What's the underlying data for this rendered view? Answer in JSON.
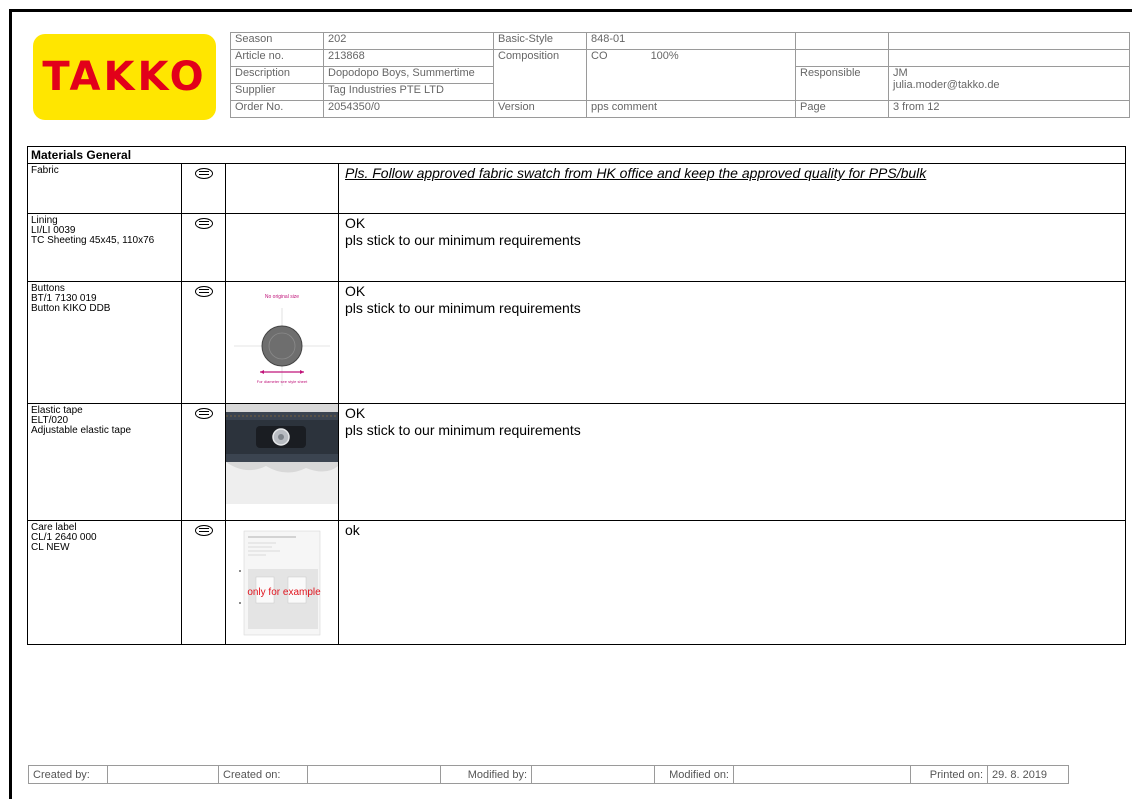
{
  "logo": {
    "text": "TAKKO",
    "colors": {
      "background": "#ffe600",
      "text": "#e2001a"
    }
  },
  "header": {
    "season_label": "Season",
    "season_value": "202",
    "basic_style_label": "Basic-Style",
    "basic_style_value": "848-01",
    "article_label": "Article no.",
    "article_value": "213868",
    "composition_label": "Composition",
    "composition_material": "CO",
    "composition_percent": "100%",
    "description_label": "Description",
    "description_value": "Dopodopo Boys, Summertime",
    "responsible_label": "Responsible",
    "responsible_initials": "JM",
    "responsible_email": "julia.moder@takko.de",
    "supplier_label": "Supplier",
    "supplier_value": "Tag Industries PTE LTD",
    "order_label": "Order No.",
    "order_value": "2054350/0",
    "version_label": "Version",
    "version_value": "pps comment",
    "page_label": "Page",
    "page_value": "3 from 12"
  },
  "materials": {
    "title": "Materials General",
    "rows": [
      {
        "label_lines": [
          "Fabric"
        ],
        "icon": "comment-icon",
        "comment_lines": [
          "Pls. Follow approved fabric swatch from HK office and keep the approved quality for PPS/bulk"
        ]
      },
      {
        "label_lines": [
          "Lining",
          "LI/LI 0039",
          "TC Sheeting 45x45, 110x76"
        ],
        "icon": "comment-icon",
        "comment_lines": [
          "OK",
          "pls stick to our minimum requirements"
        ]
      },
      {
        "label_lines": [
          "Buttons",
          "BT/1  7130 019",
          "Button KIKO DDB"
        ],
        "icon": "comment-icon",
        "image_text": {
          "top": "No original size",
          "bottom": "For diameter see style sheet"
        },
        "comment_lines": [
          "OK",
          "pls stick to our minimum requirements"
        ]
      },
      {
        "label_lines": [
          "Elastic tape",
          "ELT/020",
          "Adjustable elastic tape"
        ],
        "icon": "comment-icon",
        "comment_lines": [
          "OK",
          "pls stick to our minimum requirements"
        ]
      },
      {
        "label_lines": [
          "Care label",
          "CL/1  2640 000",
          "CL NEW"
        ],
        "icon": "comment-icon",
        "image_text": {
          "stamp": "only for example"
        },
        "comment_lines": [
          "ok"
        ]
      }
    ]
  },
  "footer": {
    "created_by_label": "Created by:",
    "created_on_label": "Created on:",
    "modified_by_label": "Modified by:",
    "modified_on_label": "Modified on:",
    "printed_on_label": "Printed on:",
    "printed_on_value": "29. 8. 2019"
  }
}
